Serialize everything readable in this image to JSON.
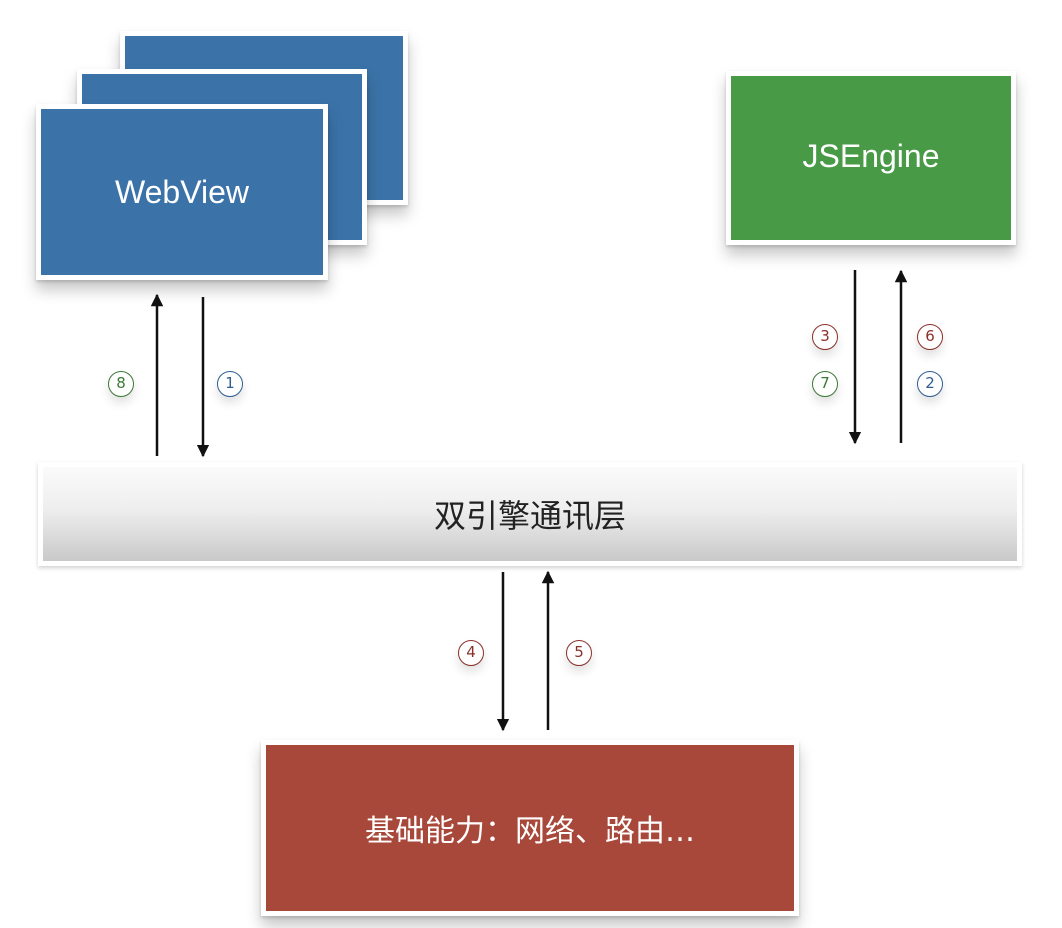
{
  "webview": {
    "label": "WebView"
  },
  "jsengine": {
    "label": "JSEngine"
  },
  "bridge": {
    "label": "双引擎通讯层"
  },
  "base": {
    "label": "基础能力：网络、路由…"
  },
  "steps": [
    "1",
    "2",
    "3",
    "4",
    "5",
    "6",
    "7",
    "8"
  ],
  "colors": {
    "webview": "#3b73a8",
    "jsengine": "#489a47",
    "base": "#a8483a",
    "badge_green": "#3a7a34",
    "badge_blue": "#2f5d92",
    "badge_red": "#8b2f2a"
  }
}
